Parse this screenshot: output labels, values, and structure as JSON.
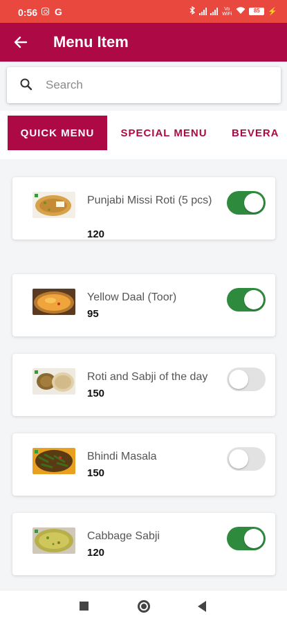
{
  "status_bar": {
    "time": "0:56",
    "g_label": "G",
    "vowifi": "Vo WiFi",
    "battery": "85"
  },
  "app_bar": {
    "title": "Menu Item"
  },
  "search": {
    "placeholder": "Search",
    "value": ""
  },
  "tabs": [
    {
      "label": "QUICK MENU",
      "active": true
    },
    {
      "label": "SPECIAL MENU",
      "active": false
    },
    {
      "label": "BEVERA",
      "active": false
    }
  ],
  "items": [
    {
      "name": "Punjabi Missi Roti (5 pcs)",
      "price": "120",
      "available": true,
      "image": "missi-roti-image"
    },
    {
      "name": "Yellow Daal (Toor)",
      "price": "95",
      "available": true,
      "image": "yellow-daal-image"
    },
    {
      "name": "Roti and Sabji of the day",
      "price": "150",
      "available": false,
      "image": "roti-sabji-image"
    },
    {
      "name": "Bhindi Masala",
      "price": "150",
      "available": false,
      "image": "bhindi-masala-image"
    },
    {
      "name": "Cabbage Sabji",
      "price": "120",
      "available": true,
      "image": "cabbage-sabji-image"
    }
  ],
  "colors": {
    "status_bar": "#e9483f",
    "app_bar": "#ad0a45",
    "toggle_on": "#2e8b3e",
    "toggle_off": "#e2e2e2"
  }
}
